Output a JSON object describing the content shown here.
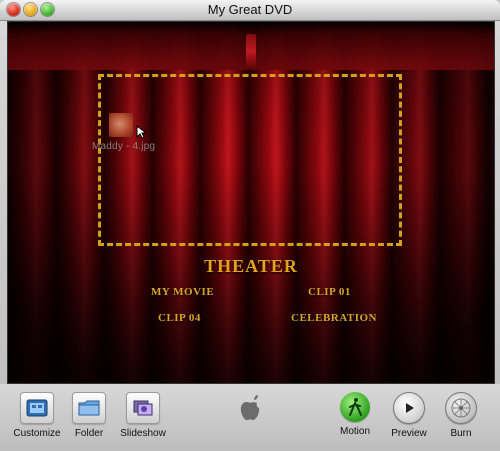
{
  "window": {
    "title": "My Great DVD"
  },
  "stage": {
    "drag_item_label": "Maddy - 4.jpg",
    "menu_title": "THEATER",
    "menu_buttons": [
      "MY MOVIE",
      "CLIP 01",
      "CLIP 04",
      "CELEBRATION"
    ]
  },
  "toolbar": {
    "left": [
      "Customize",
      "Folder",
      "Slideshow"
    ],
    "right": [
      "Motion",
      "Preview",
      "Burn"
    ],
    "icons": {
      "customize": "customize-icon",
      "folder": "folder-icon",
      "slideshow": "slideshow-icon",
      "apple": "apple-logo-icon",
      "motion": "motion-walking-icon",
      "preview": "play-icon",
      "burn": "burn-icon"
    }
  },
  "colors": {
    "menu_gold": "#d9a329",
    "dropzone_yellow": "#d4a017",
    "curtain_red": "#9b0d14"
  }
}
